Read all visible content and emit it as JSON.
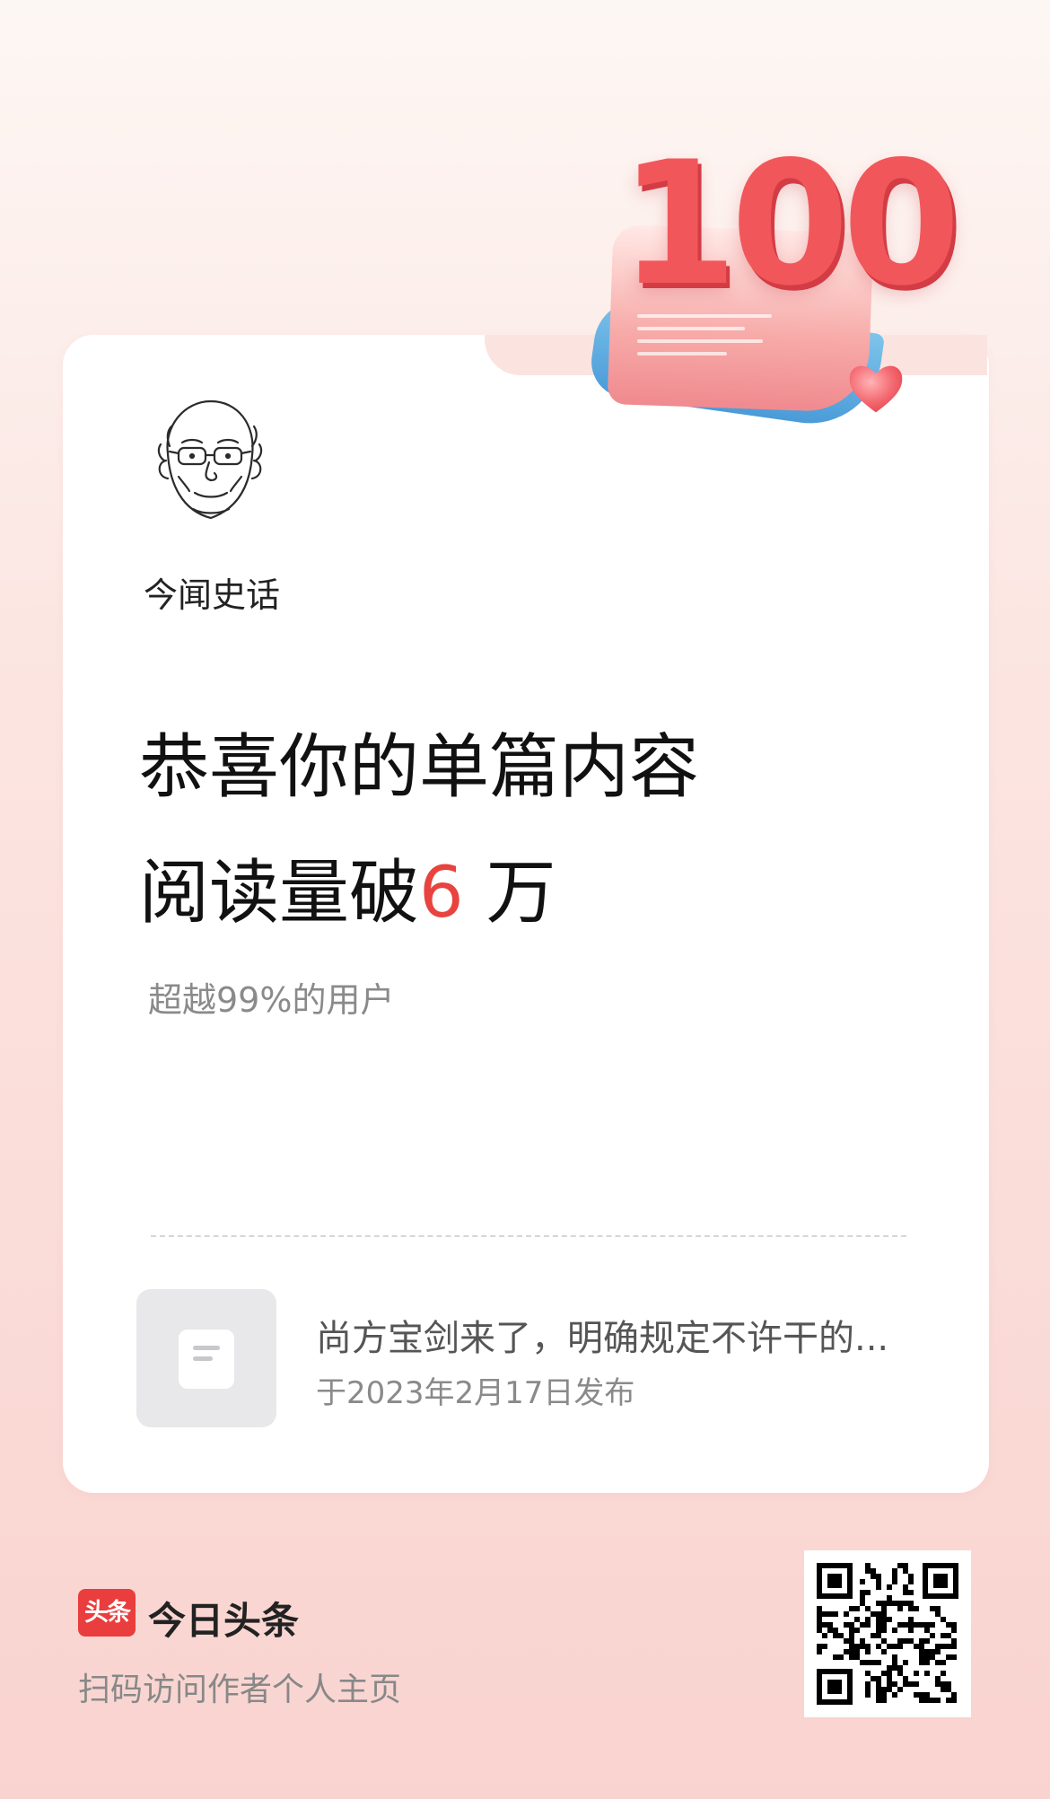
{
  "milestone": {
    "badge_number": "100"
  },
  "author": {
    "name": "今闻史话"
  },
  "headline": {
    "line1": "恭喜你的单篇内容",
    "line2_prefix": "阅读量破",
    "line2_number": "6",
    "line2_suffix": " 万"
  },
  "subtext": "超越99%的用户",
  "article": {
    "title": "尚方宝剑来了，明确规定不许干的...",
    "date": "于2023年2月17日发布",
    "thumbnail_icon": "document-icon"
  },
  "footer": {
    "brand_logo_text": "头条",
    "brand_name": "今日头条",
    "caption": "扫码访问作者个人主页"
  },
  "colors": {
    "accent": "#e8433f",
    "brand_red": "#ea3d3d"
  }
}
